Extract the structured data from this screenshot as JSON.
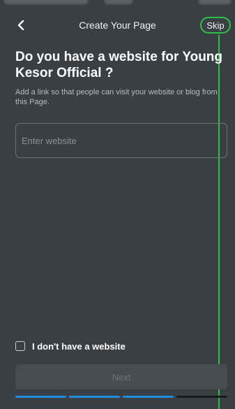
{
  "header": {
    "title": "Create Your Page",
    "back_icon": "chevron-left-icon",
    "skip_label": "Skip"
  },
  "main": {
    "heading": "Do you have a website for Young Kesor Official ?",
    "description": "Add a link so that people can visit your website or blog from this Page.",
    "website_input": {
      "value": "",
      "placeholder": "Enter website"
    },
    "no_website_checkbox": {
      "label": "I don't have a website",
      "checked": false
    },
    "next_label": "Next",
    "next_enabled": false
  },
  "progress": {
    "total_steps": 4,
    "completed_steps": 3
  },
  "colors": {
    "background": "#3a3f43",
    "annotation": "#2fbf49",
    "progress_active": "#1f8ee0",
    "button_disabled": "#474c51"
  }
}
